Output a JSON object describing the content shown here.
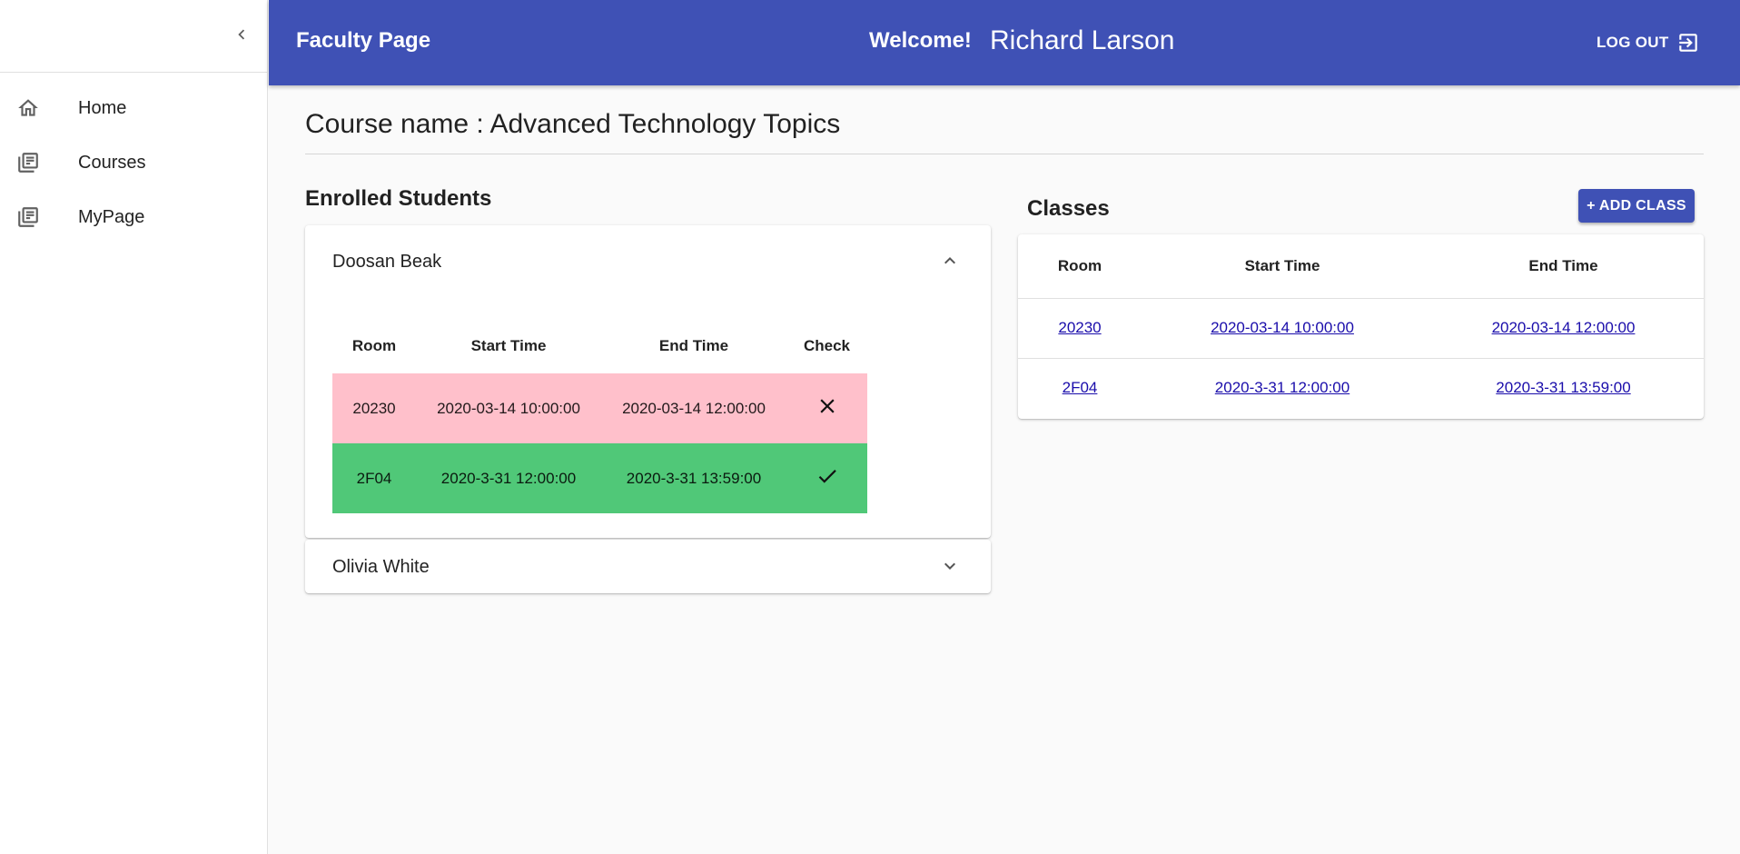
{
  "sidebar": {
    "items": [
      {
        "label": "Home",
        "icon": "home-icon"
      },
      {
        "label": "Courses",
        "icon": "library-books-icon"
      },
      {
        "label": "MyPage",
        "icon": "library-books-icon"
      }
    ]
  },
  "header": {
    "title": "Faculty Page",
    "welcome": "Welcome!",
    "user_name": "Richard Larson",
    "logout_label": "LOG OUT"
  },
  "course": {
    "name_text": "Course name : Advanced Technology Topics"
  },
  "enrolled": {
    "title": "Enrolled Students",
    "columns": {
      "room": "Room",
      "start": "Start Time",
      "end": "End Time",
      "check": "Check"
    },
    "students": [
      {
        "name": "Doosan Beak",
        "expanded": true,
        "rows": [
          {
            "room": "20230",
            "start": "2020-03-14 10:00:00",
            "end": "2020-03-14 12:00:00",
            "check": "✕",
            "status": "absent"
          },
          {
            "room": "2F04",
            "start": "2020-3-31 12:00:00",
            "end": "2020-3-31 13:59:00",
            "check": "✓",
            "status": "present"
          }
        ]
      },
      {
        "name": "Olivia White",
        "expanded": false
      }
    ]
  },
  "classes": {
    "title": "Classes",
    "add_label": "+ ADD CLASS",
    "columns": {
      "room": "Room",
      "start": "Start Time",
      "end": "End Time"
    },
    "rows": [
      {
        "room": "20230",
        "start": "2020-03-14 10:00:00",
        "end": "2020-03-14 12:00:00"
      },
      {
        "room": "2F04",
        "start": "2020-3-31 12:00:00",
        "end": "2020-3-31 13:59:00"
      }
    ]
  },
  "colors": {
    "primary": "#3f51b5",
    "absent": "#ffc0cb",
    "present": "#50c878",
    "link": "#1a0dab"
  }
}
